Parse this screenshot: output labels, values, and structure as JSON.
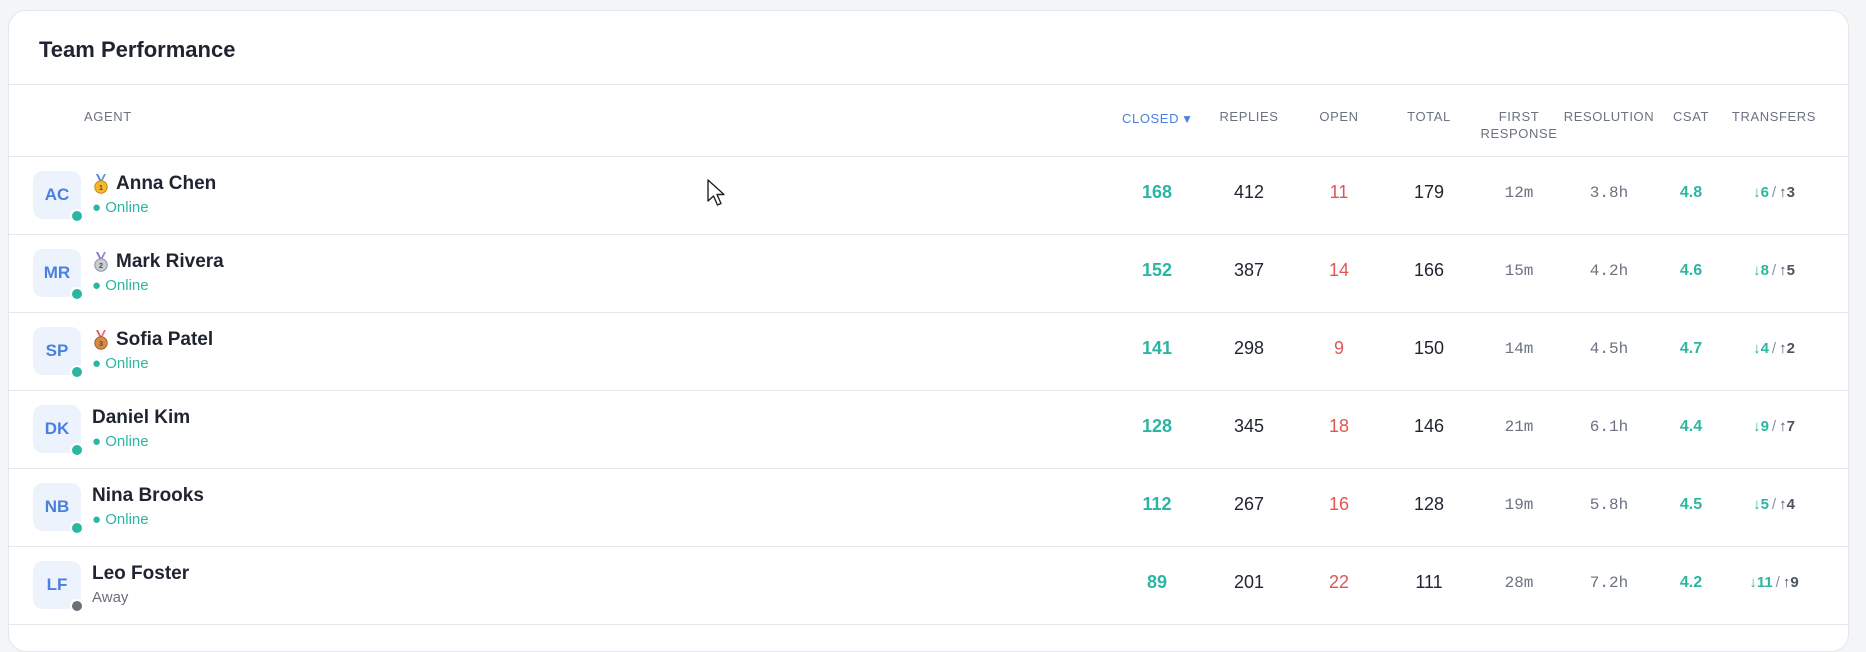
{
  "card": {
    "title": "Team Performance"
  },
  "columns": {
    "agent": "AGENT",
    "closed": "CLOSED",
    "replies": "REPLIES",
    "open": "OPEN",
    "total": "TOTAL",
    "first_response_1": "FIRST",
    "first_response_2": "RESPONSE",
    "resolution": "RESOLUTION",
    "csat": "CSAT",
    "transfers": "TRANSFERS"
  },
  "colors": {
    "online": "#2bb6a3",
    "away": "#6b6f76",
    "accent": "#4a7fe0",
    "open": "#e25555"
  },
  "agents": [
    {
      "initials": "AC",
      "name": "Anna Chen",
      "medal": "gold-medal-icon",
      "status": "● Online",
      "status_type": "online",
      "closed": "168",
      "replies": "412",
      "open": "11",
      "total": "179",
      "first_response": "12m",
      "resolution": "3.8h",
      "csat": "4.8",
      "transfers_in": "↓6",
      "transfers_out": "↑3"
    },
    {
      "initials": "MR",
      "name": "Mark Rivera",
      "medal": "silver-medal-icon",
      "status": "● Online",
      "status_type": "online",
      "closed": "152",
      "replies": "387",
      "open": "14",
      "total": "166",
      "first_response": "15m",
      "resolution": "4.2h",
      "csat": "4.6",
      "transfers_in": "↓8",
      "transfers_out": "↑5"
    },
    {
      "initials": "SP",
      "name": "Sofia Patel",
      "medal": "bronze-medal-icon",
      "status": "● Online",
      "status_type": "online",
      "closed": "141",
      "replies": "298",
      "open": "9",
      "total": "150",
      "first_response": "14m",
      "resolution": "4.5h",
      "csat": "4.7",
      "transfers_in": "↓4",
      "transfers_out": "↑2"
    },
    {
      "initials": "DK",
      "name": "Daniel Kim",
      "medal": "",
      "status": "● Online",
      "status_type": "online",
      "closed": "128",
      "replies": "345",
      "open": "18",
      "total": "146",
      "first_response": "21m",
      "resolution": "6.1h",
      "csat": "4.4",
      "transfers_in": "↓9",
      "transfers_out": "↑7"
    },
    {
      "initials": "NB",
      "name": "Nina Brooks",
      "medal": "",
      "status": "● Online",
      "status_type": "online",
      "closed": "112",
      "replies": "267",
      "open": "16",
      "total": "128",
      "first_response": "19m",
      "resolution": "5.8h",
      "csat": "4.5",
      "transfers_in": "↓5",
      "transfers_out": "↑4"
    },
    {
      "initials": "LF",
      "name": "Leo Foster",
      "medal": "",
      "status": "Away",
      "status_type": "away",
      "closed": "89",
      "replies": "201",
      "open": "22",
      "total": "111",
      "first_response": "28m",
      "resolution": "7.2h",
      "csat": "4.2",
      "transfers_in": "↓11",
      "transfers_out": "↑9"
    }
  ]
}
